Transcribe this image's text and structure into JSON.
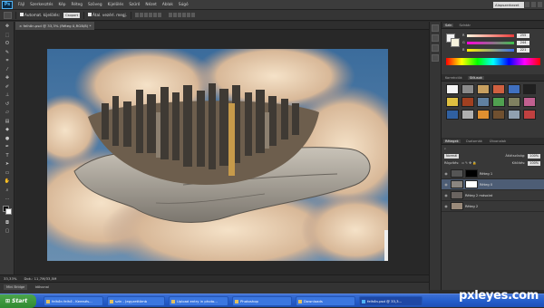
{
  "menubar": {
    "logo": "Ps",
    "items": [
      "Fájl",
      "Szerkesztés",
      "Kép",
      "Réteg",
      "Szöveg",
      "Kijelölés",
      "Szűrő",
      "Nézet",
      "Ablak",
      "Súgó"
    ],
    "workspace": "Alapszerkezet"
  },
  "options": {
    "auto_select_label": "Automat. kijelölés:",
    "auto_select_value": "Csoport",
    "transform_label": "Átal. vezérl. megj."
  },
  "document": {
    "tab_title": "felhőn.psd @ 33,3% (Réteg 0,RGB/8) *"
  },
  "status": {
    "zoom": "33,33%",
    "doc_size": "Dok.: 11,7M/33,5M"
  },
  "bottom_panel": {
    "tabs": [
      "Mini Bridge",
      "Idővonal"
    ]
  },
  "panels": {
    "color_tabs": [
      "Szín",
      "Színtár"
    ],
    "sliders": [
      {
        "label": "R",
        "value": "255",
        "color": "#e83b3b"
      },
      {
        "label": "G",
        "value": "244",
        "color": "#3bc24b"
      },
      {
        "label": "B",
        "value": "221",
        "color": "#3b6be8"
      }
    ],
    "styles_tabs": [
      "Korrekciók",
      "Stílusok"
    ],
    "style_swatches": [
      "#f5f5f5",
      "#8a8a8a",
      "#c8a060",
      "#d06040",
      "#4070c0",
      "#202020",
      "#e0c040",
      "#a04020",
      "#6080a0",
      "#50a050",
      "#808060",
      "#c06090",
      "#3060a0",
      "#b0b0b0",
      "#e09030",
      "#705030",
      "#90a0b0",
      "#c04040"
    ],
    "layers_tabs": [
      "Rétegek",
      "Csatornák",
      "Útvonalak"
    ],
    "blend_mode": "Normál",
    "opacity_label": "Átlátszóság:",
    "opacity_value": "100%",
    "lock_label": "Rögzítés:",
    "fill_label": "Kitöltés:",
    "fill_value": "100%",
    "layers": [
      {
        "name": "Réteg 1",
        "selected": false
      },
      {
        "name": "Réteg 0",
        "selected": true
      },
      {
        "name": "Réteg 2 másolat",
        "selected": false
      },
      {
        "name": "Réteg 2",
        "selected": false
      }
    ]
  },
  "taskbar": {
    "start": "Start",
    "items": [
      "felhőn felhő - Keresés...",
      "szín - Jegyzettömb",
      "Upload entry in photo...",
      "Photoshop",
      "Downloads",
      "felhőn.psd @ 33,3..."
    ]
  },
  "watermark": "pxleyes.com"
}
